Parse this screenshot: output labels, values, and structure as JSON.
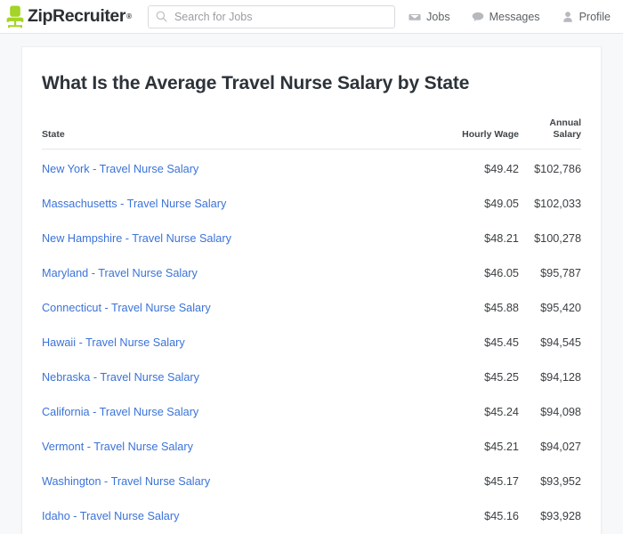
{
  "header": {
    "brand": {
      "name": "ZipRecruiter",
      "trademark": "®",
      "logo_icon": "office-chair-icon",
      "logo_color": "#a4d425"
    },
    "search": {
      "placeholder": "Search for Jobs",
      "value": "",
      "icon": "search-icon"
    },
    "nav": [
      {
        "label": "Jobs",
        "icon": "briefcase-icon"
      },
      {
        "label": "Messages",
        "icon": "speech-bubble-icon"
      },
      {
        "label": "Profile",
        "icon": "person-icon"
      }
    ]
  },
  "main": {
    "title": "What Is the Average Travel Nurse Salary by State",
    "table": {
      "columns": {
        "state": "State",
        "hourly": "Hourly Wage",
        "annual_line1": "Annual",
        "annual_line2": "Salary"
      },
      "rows": [
        {
          "state": "New York - Travel Nurse Salary",
          "hourly": "$49.42",
          "annual": "$102,786"
        },
        {
          "state": "Massachusetts - Travel Nurse Salary",
          "hourly": "$49.05",
          "annual": "$102,033"
        },
        {
          "state": "New Hampshire - Travel Nurse Salary",
          "hourly": "$48.21",
          "annual": "$100,278"
        },
        {
          "state": "Maryland - Travel Nurse Salary",
          "hourly": "$46.05",
          "annual": "$95,787"
        },
        {
          "state": "Connecticut - Travel Nurse Salary",
          "hourly": "$45.88",
          "annual": "$95,420"
        },
        {
          "state": "Hawaii - Travel Nurse Salary",
          "hourly": "$45.45",
          "annual": "$94,545"
        },
        {
          "state": "Nebraska - Travel Nurse Salary",
          "hourly": "$45.25",
          "annual": "$94,128"
        },
        {
          "state": "California - Travel Nurse Salary",
          "hourly": "$45.24",
          "annual": "$94,098"
        },
        {
          "state": "Vermont - Travel Nurse Salary",
          "hourly": "$45.21",
          "annual": "$94,027"
        },
        {
          "state": "Washington - Travel Nurse Salary",
          "hourly": "$45.17",
          "annual": "$93,952"
        },
        {
          "state": "Idaho - Travel Nurse Salary",
          "hourly": "$45.16",
          "annual": "$93,928"
        }
      ]
    }
  },
  "colors": {
    "link": "#3b73d8",
    "brand_green": "#a4d425",
    "text": "#3c4043",
    "page_bg": "#f7f8f9"
  }
}
